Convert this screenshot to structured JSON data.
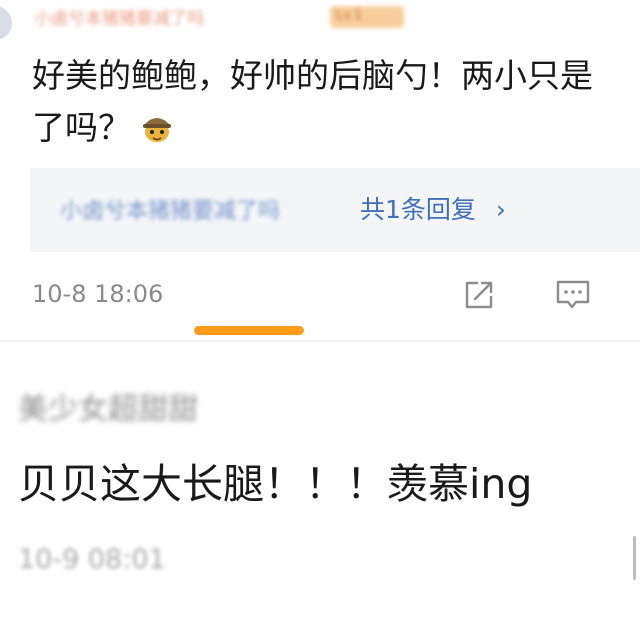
{
  "comment1": {
    "author": "小卤兮本猪猪要减了吗",
    "badge": "Lv.1",
    "text_line1": "好美的鲍鲍，好帅的后脑勺！两小只是",
    "text_line2": "了吗？",
    "emoji": "detective-pikachu-emoji",
    "reply_preview": {
      "author": "小卤兮本猪猪要减了吗",
      "count_label": "共1条回复",
      "chevron": "›"
    },
    "timestamp": "10-8 18:06",
    "share_icon": "share-icon",
    "comment_icon": "comment-icon"
  },
  "tab_indicator_color": "#ff9b17",
  "comment2": {
    "author": "美少女超甜甜",
    "text": "贝贝这大长腿！！！羡慕ing",
    "timestamp": "10-9 08:01"
  },
  "colors": {
    "link": "#406fb8",
    "reply_bg": "#f4f5f7",
    "accent": "#ff9b17"
  }
}
